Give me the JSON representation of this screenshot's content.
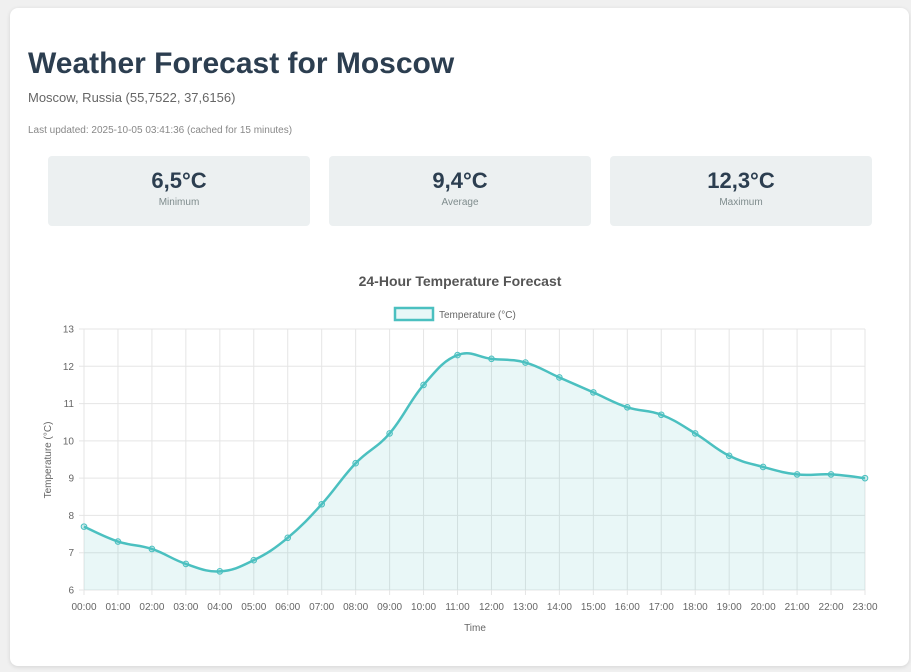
{
  "header": {
    "title": "Weather Forecast for Moscow",
    "location": "Moscow, Russia (55,7522, 37,6156)",
    "last_updated": "Last updated: 2025-10-05 03:41:36 (cached for 15 minutes)"
  },
  "stats": [
    {
      "value": "6,5°C",
      "label": "Minimum"
    },
    {
      "value": "9,4°C",
      "label": "Average"
    },
    {
      "value": "12,3°C",
      "label": "Maximum"
    }
  ],
  "chart_data": {
    "type": "line",
    "title": "24-Hour Temperature Forecast",
    "xlabel": "Time",
    "ylabel": "Temperature (°C)",
    "ylim": [
      6,
      13
    ],
    "yticks": [
      6,
      7,
      8,
      9,
      10,
      11,
      12,
      13
    ],
    "grid": true,
    "legend_position": "top",
    "categories": [
      "00:00",
      "01:00",
      "02:00",
      "03:00",
      "04:00",
      "05:00",
      "06:00",
      "07:00",
      "08:00",
      "09:00",
      "10:00",
      "11:00",
      "12:00",
      "13:00",
      "14:00",
      "15:00",
      "16:00",
      "17:00",
      "18:00",
      "19:00",
      "20:00",
      "21:00",
      "22:00",
      "23:00"
    ],
    "series": [
      {
        "name": "Temperature (°C)",
        "color": "#4bc0c0",
        "fill": "rgba(75,192,192,0.12)",
        "values": [
          7.7,
          7.3,
          7.1,
          6.7,
          6.5,
          6.8,
          7.4,
          8.3,
          9.4,
          10.2,
          11.5,
          12.3,
          12.2,
          12.1,
          11.7,
          11.3,
          10.9,
          10.7,
          10.2,
          9.6,
          9.3,
          9.1,
          9.1,
          9.0
        ]
      }
    ]
  }
}
